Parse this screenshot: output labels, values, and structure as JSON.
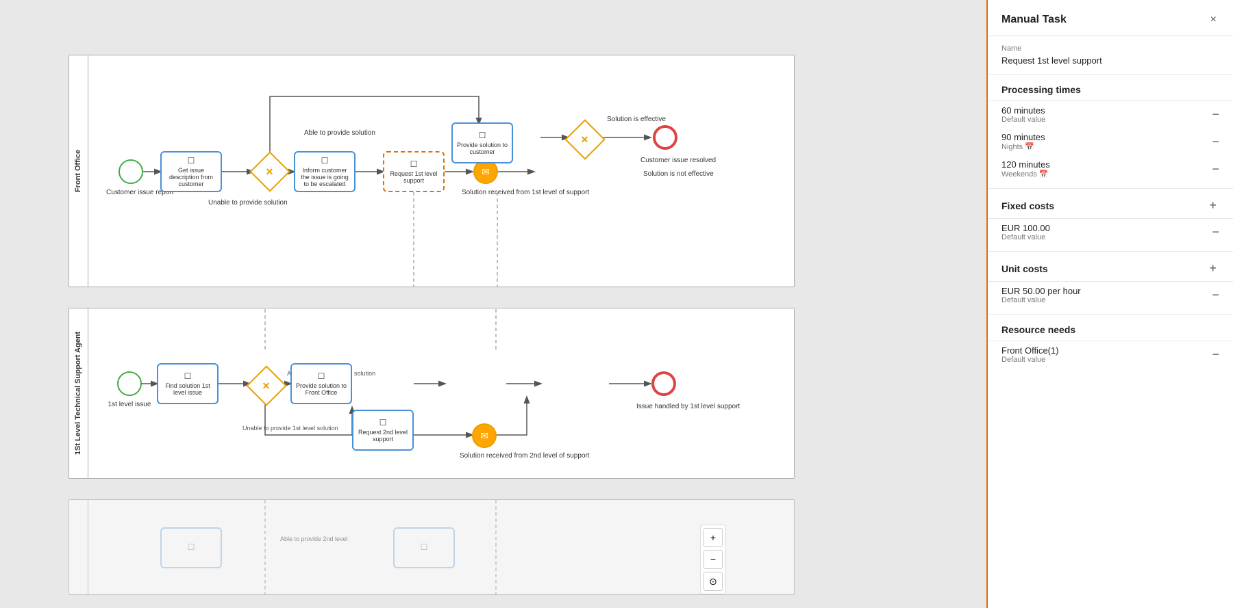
{
  "panel": {
    "title": "Manual Task",
    "close_label": "×",
    "name_label": "Name",
    "name_value": "Request 1st level support",
    "processing_times": {
      "section_title": "Processing times",
      "items": [
        {
          "value": "60 minutes",
          "sublabel": "Default value",
          "has_calendar": false
        },
        {
          "value": "90 minutes",
          "sublabel": "Nights",
          "has_calendar": true
        },
        {
          "value": "120 minutes",
          "sublabel": "Weekends",
          "has_calendar": true
        }
      ]
    },
    "fixed_costs": {
      "section_title": "Fixed costs",
      "items": [
        {
          "value": "EUR 100.00",
          "sublabel": "Default value"
        }
      ]
    },
    "unit_costs": {
      "section_title": "Unit costs",
      "items": [
        {
          "value": "EUR 50.00 per hour",
          "sublabel": "Default value"
        }
      ]
    },
    "resource_needs": {
      "section_title": "Resource needs",
      "items": [
        {
          "value": "Front Office(1)",
          "sublabel": "Default value"
        }
      ]
    }
  },
  "zoom": {
    "in_label": "+",
    "out_label": "−",
    "fit_label": "⊙"
  },
  "diagram": {
    "pool1_label": "Front Office",
    "pool2_label": "1St Level Technical Support Agent",
    "pool3_label": ""
  }
}
